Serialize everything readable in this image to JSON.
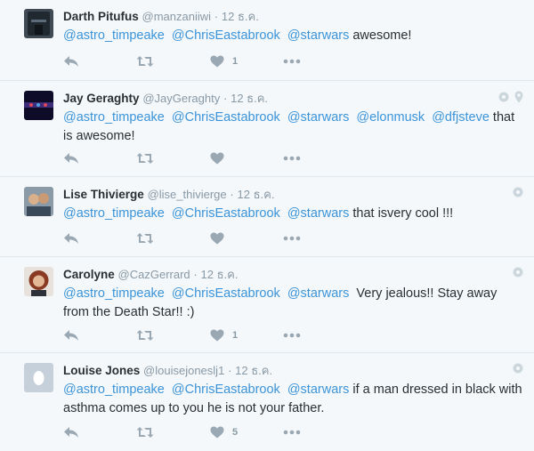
{
  "tweets": [
    {
      "fullname": "Darth Pitufus",
      "username": "@manzaniiwi",
      "dot": "·",
      "time": "12 ธ.ค.",
      "mentions": [
        "@astro_timpeake",
        "@ChrisEastabrook",
        "@starwars"
      ],
      "text_rest": " awesome!",
      "like_count": "1",
      "avatar_color": "#2a3340"
    },
    {
      "fullname": "Jay Geraghty",
      "username": "@JayGeraghty",
      "dot": "·",
      "time": "12 ธ.ค.",
      "mentions": [
        "@astro_timpeake",
        "@ChrisEastabrook",
        "@starwars",
        "@elonmusk",
        "@dfjsteve"
      ],
      "text_rest": " that is awesome!",
      "like_count": "",
      "avatar_color": "#1b1640"
    },
    {
      "fullname": "Lise Thivierge",
      "username": "@lise_thivierge",
      "dot": "·",
      "time": "12 ธ.ค.",
      "mentions": [
        "@astro_timpeake",
        "@ChrisEastabrook",
        "@starwars"
      ],
      "text_rest": " that isvery cool !!!",
      "like_count": "",
      "avatar_color": "#6e7f8c"
    },
    {
      "fullname": "Carolyne",
      "username": "@CazGerrard",
      "dot": "·",
      "time": "12 ธ.ค.",
      "mentions": [
        "@astro_timpeake",
        "@ChrisEastabrook",
        "@starwars"
      ],
      "text_rest": "  Very jealous!! Stay away from the Death Star!! :)",
      "like_count": "1",
      "avatar_color": "#8a5a3c"
    },
    {
      "fullname": "Louise Jones",
      "username": "@louisejoneslj1",
      "dot": "·",
      "time": "12 ธ.ค.",
      "mentions": [
        "@astro_timpeake",
        "@ChrisEastabrook",
        "@starwars"
      ],
      "text_rest": " if a man dressed in black with asthma comes up to you he is not your father.",
      "like_count": "5",
      "avatar_color": "#c5d0da"
    }
  ],
  "icons": {
    "reply": "reply-icon",
    "retweet": "retweet-icon",
    "like": "heart-icon",
    "more": "more-icon",
    "conversation": "conversation-icon",
    "location": "location-icon"
  },
  "colors": {
    "link": "#3b94d9",
    "muted": "#8899a6",
    "icon": "#9aa8b4",
    "background": "#f5f8fa",
    "divider": "#e1e8ed"
  }
}
